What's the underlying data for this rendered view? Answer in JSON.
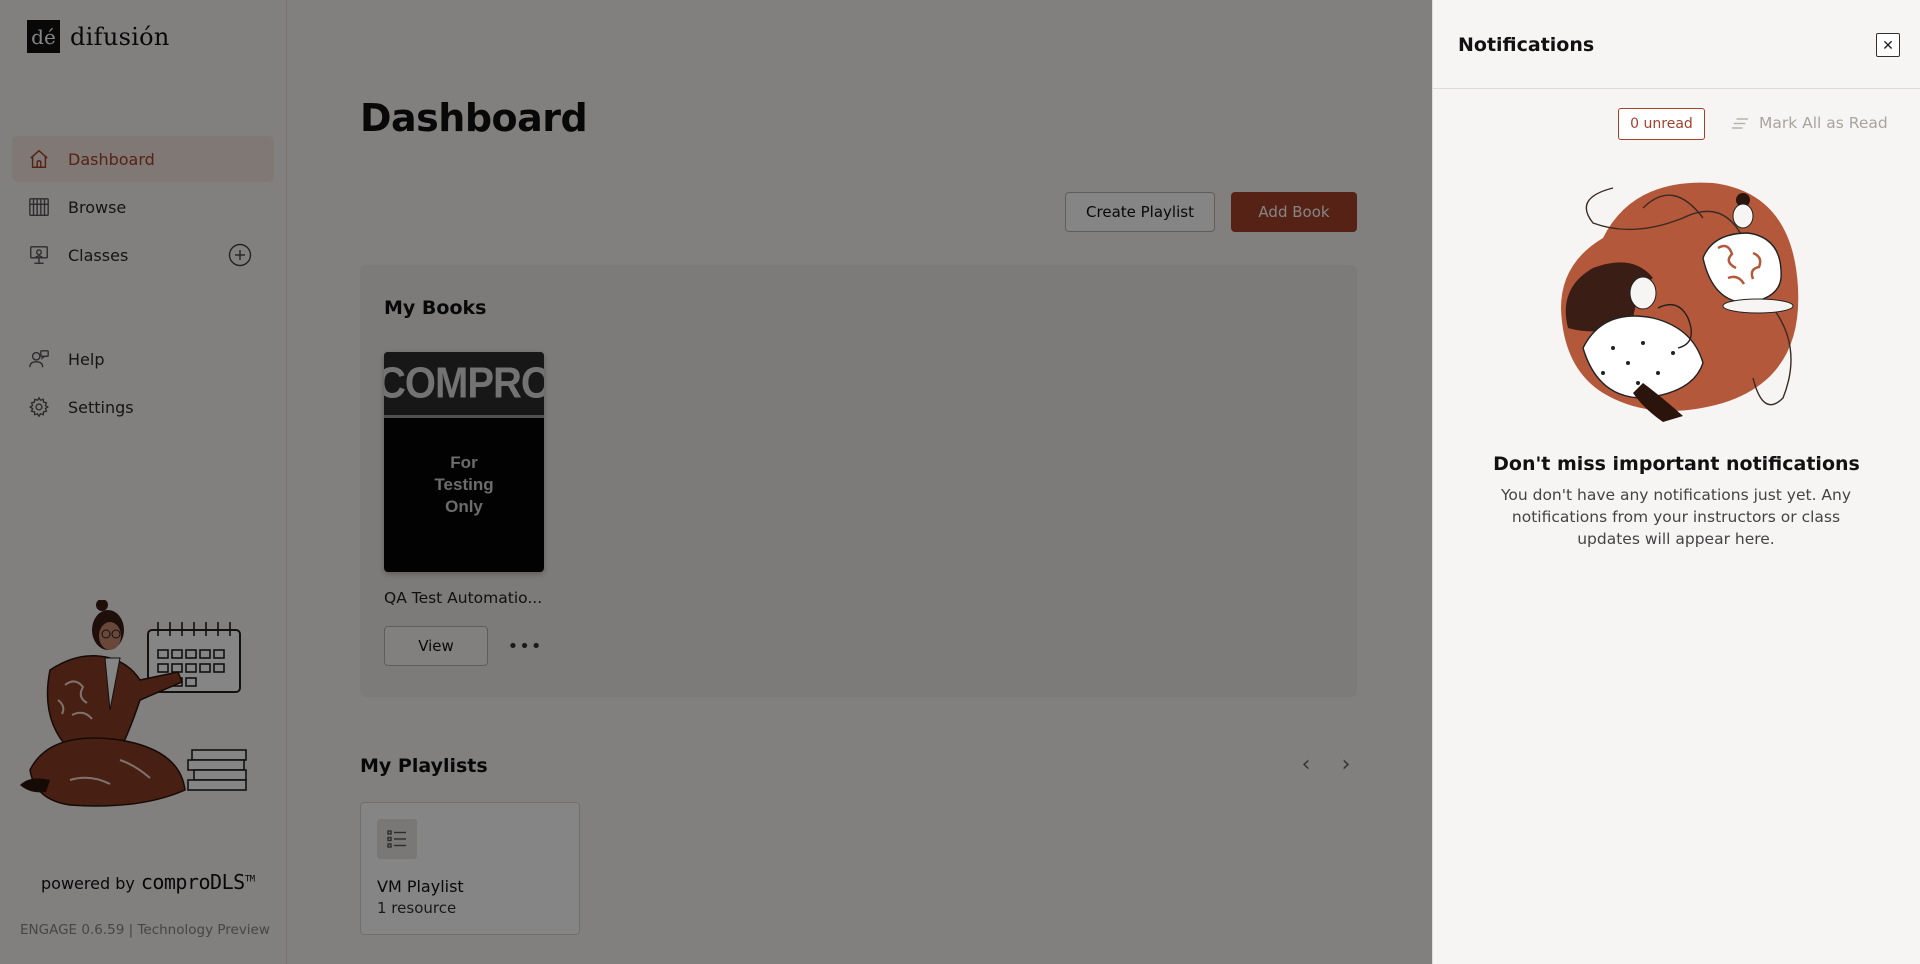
{
  "app": {
    "logo_mark": "dé",
    "logo_text": "difusión"
  },
  "sidebar": {
    "items": [
      {
        "label": "Dashboard",
        "icon": "home-icon",
        "active": true
      },
      {
        "label": "Browse",
        "icon": "library-icon"
      },
      {
        "label": "Classes",
        "icon": "classroom-icon"
      },
      {
        "label": "Help",
        "icon": "help-person-icon"
      },
      {
        "label": "Settings",
        "icon": "gear-icon"
      }
    ],
    "powered_by": "powered by",
    "powered_brand": "comproDLS",
    "powered_tm": "TM",
    "version": "ENGAGE 0.6.59 | Technology Preview"
  },
  "main": {
    "title": "Dashboard",
    "create_playlist": "Create Playlist",
    "add_book": "Add Book",
    "my_books": {
      "title": "My Books",
      "books": [
        {
          "cover_top": "COMPRO",
          "cover_bottom": "For\nTesting\nOnly",
          "name": "QA Test Automatio...",
          "view_label": "View",
          "more_label": "•••"
        }
      ]
    },
    "my_playlists": {
      "title": "My Playlists",
      "prev": "‹",
      "next": "›",
      "items": [
        {
          "name": "VM Playlist",
          "count": "1 resource"
        }
      ]
    }
  },
  "notifications": {
    "title": "Notifications",
    "close": "✕",
    "unread": "0 unread",
    "mark_all": "Mark All as Read",
    "empty_title": "Don't miss important notifications",
    "empty_desc": "You don't have any notifications just yet. Any notifications from your instructors or class updates will appear here."
  },
  "colors": {
    "accent": "#a3412a",
    "active_bg": "#f6e6de",
    "overlay": "rgba(0,0,0,0.48)"
  }
}
